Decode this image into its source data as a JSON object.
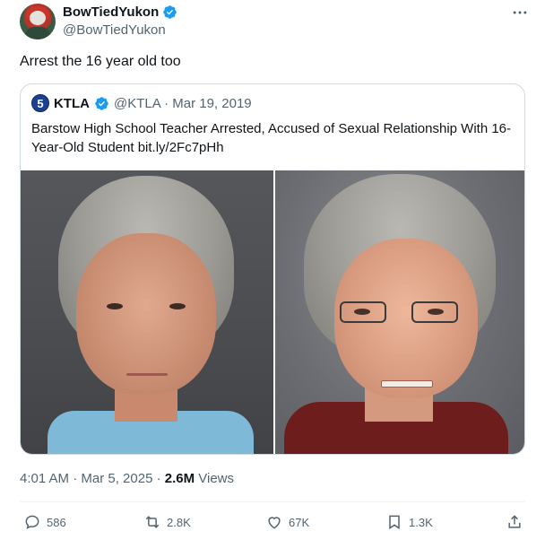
{
  "author": {
    "name": "BowTiedYukon",
    "handle": "@BowTiedYukon",
    "verified": true
  },
  "more_icon": "more-horizontal-icon",
  "tweet": {
    "text": "Arrest the 16 year old too"
  },
  "quote": {
    "logo_text": "5",
    "name": "KTLA",
    "handle_date": "@KTLA · Mar 19, 2019",
    "text": "Barstow High School Teacher Arrested, Accused of Sexual Relationship With 16-Year-Old Student bit.ly/2Fc7pHh"
  },
  "meta": {
    "time": "4:01 AM · Mar 5, 2025 · ",
    "views_count": "2.6M",
    "views_label": " Views"
  },
  "actions": {
    "replies": "586",
    "reposts": "2.8K",
    "likes": "67K",
    "bookmarks": "1.3K"
  },
  "colors": {
    "verified": "#1d9bf0",
    "secondary_text": "#536471",
    "border": "#cfd9de"
  }
}
